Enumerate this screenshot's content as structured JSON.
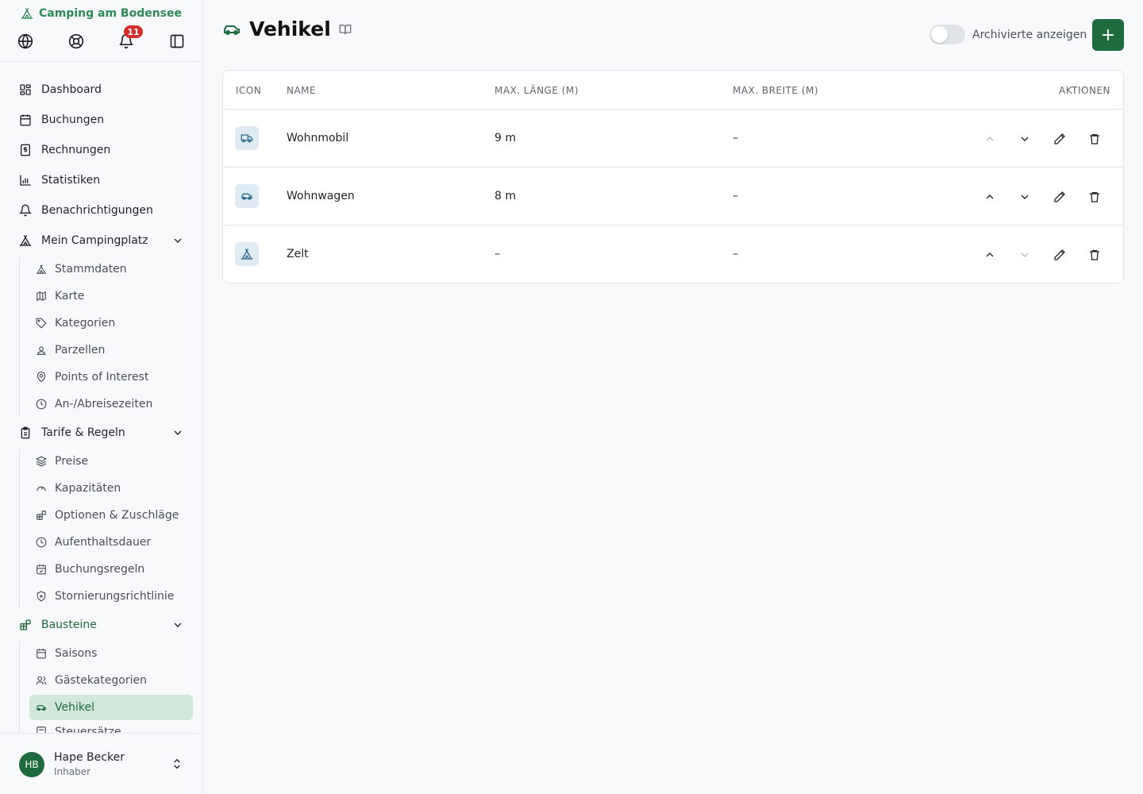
{
  "sidebar": {
    "brand": "Camping am Bodensee",
    "notification_count": "11",
    "nav": {
      "dashboard": "Dashboard",
      "buchungen": "Buchungen",
      "rechnungen": "Rechnungen",
      "statistiken": "Statistiken",
      "benachrichtigungen": "Benachrichtigungen",
      "mein_campingplatz": "Mein Campingplatz",
      "mein_campingplatz_items": [
        "Stammdaten",
        "Karte",
        "Kategorien",
        "Parzellen",
        "Points of Interest",
        "An-/Abreisezeiten"
      ],
      "tarife": "Tarife & Regeln",
      "tarife_items": [
        "Preise",
        "Kapazitäten",
        "Optionen & Zuschläge",
        "Aufenthaltsdauer",
        "Buchungsregeln",
        "Stornierungsrichtlinie"
      ],
      "bausteine": "Bausteine",
      "bausteine_items": [
        "Saisons",
        "Gästekategorien",
        "Vehikel",
        "Steuersätze"
      ]
    },
    "user": {
      "initials": "HB",
      "name": "Hape Becker",
      "role": "Inhaber"
    }
  },
  "main": {
    "title": "Vehikel",
    "toggle_label": "Archivierte anzeigen",
    "add_label": "+",
    "table": {
      "headers": [
        "ICON",
        "NAME",
        "MAX. LÄNGE (M)",
        "MAX. BREITE (M)",
        "AKTIONEN"
      ],
      "rows": [
        {
          "icon": "truck-icon",
          "name": "Wohnmobil",
          "length": "9 m",
          "width": "–"
        },
        {
          "icon": "car-icon",
          "name": "Wohnwagen",
          "length": "8 m",
          "width": "–"
        },
        {
          "icon": "tent-icon",
          "name": "Zelt",
          "length": "–",
          "width": "–"
        }
      ]
    }
  },
  "colors": {
    "accent": "#1f6b3f",
    "brand": "#2e8b57",
    "badge": "#d32f2f"
  }
}
